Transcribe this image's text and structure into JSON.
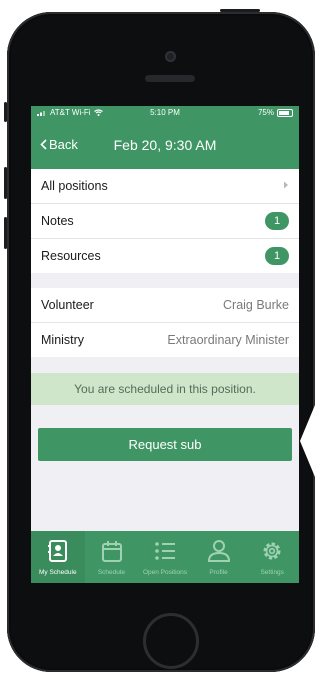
{
  "status_bar": {
    "carrier": "AT&T Wi-Fi",
    "time": "5:10 PM",
    "battery": "75%"
  },
  "nav": {
    "back_label": "Back",
    "title": "Feb 20, 9:30 AM"
  },
  "info_rows": [
    {
      "label": "All positions"
    },
    {
      "label": "Notes",
      "badge": "1"
    },
    {
      "label": "Resources",
      "badge": "1"
    }
  ],
  "detail_rows": [
    {
      "label": "Volunteer",
      "value": "Craig Burke"
    },
    {
      "label": "Ministry",
      "value": "Extraordinary Minister"
    }
  ],
  "banner": {
    "text": "You are scheduled in this position."
  },
  "request_button": {
    "label": "Request sub"
  },
  "tabs": [
    {
      "label": "My Schedule",
      "icon": "contact-card-icon",
      "active": true
    },
    {
      "label": "Schedule",
      "icon": "calendar-icon",
      "active": false
    },
    {
      "label": "Open Positions",
      "icon": "list-icon",
      "active": false
    },
    {
      "label": "Profile",
      "icon": "person-icon",
      "active": false
    },
    {
      "label": "Settings",
      "icon": "gear-icon",
      "active": false
    }
  ],
  "colors": {
    "brand_green": "#3f9664",
    "banner_green": "#cfe6cb",
    "background": "#efeff4"
  }
}
